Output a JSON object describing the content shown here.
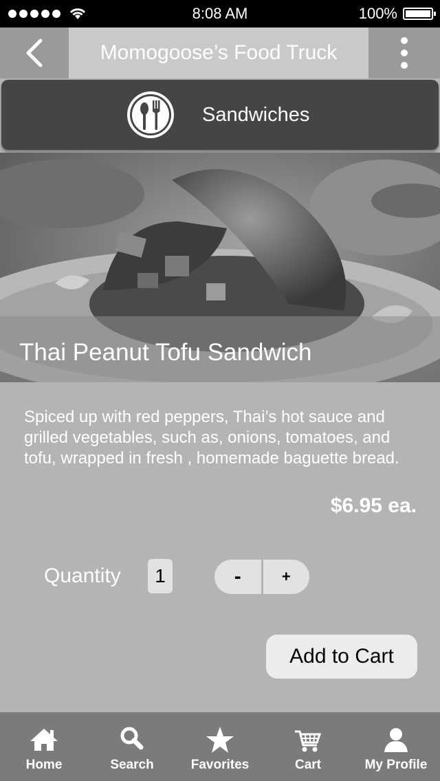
{
  "status_bar": {
    "time": "8:08 AM",
    "battery": "100%"
  },
  "header": {
    "title": "Momogoose’s Food Truck"
  },
  "category": {
    "label": "Sandwiches"
  },
  "item": {
    "title": "Thai Peanut Tofu Sandwich",
    "description": "Spiced up with red peppers, Thai’s hot sauce and grilled vegetables, such as, onions, tomatoes, and tofu, wrapped in fresh , homemade baguette bread.",
    "price": "$6.95 ea."
  },
  "quantity": {
    "label": "Quantity",
    "value": "1",
    "minus": "-",
    "plus": "+"
  },
  "actions": {
    "add_to_cart": "Add to Cart"
  },
  "tabs": [
    {
      "label": "Home",
      "icon": "home-icon"
    },
    {
      "label": "Search",
      "icon": "search-icon"
    },
    {
      "label": "Favorites",
      "icon": "star-icon"
    },
    {
      "label": "Cart",
      "icon": "cart-icon"
    },
    {
      "label": "My Profile",
      "icon": "profile-icon"
    }
  ],
  "colors": {
    "background": "#b4b4b4",
    "header": "#9a9a9a",
    "title_bar": "#c9c9c9",
    "category_bar": "#454545",
    "tab_bar": "#7b7b7b"
  }
}
